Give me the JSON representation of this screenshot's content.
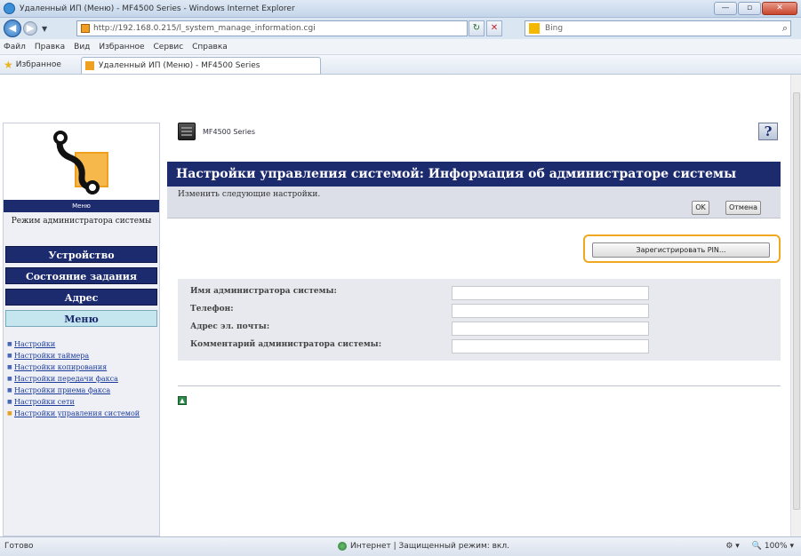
{
  "window": {
    "title": "Удаленный ИП (Меню) - MF4500 Series - Windows Internet Explorer",
    "url": "http://192.168.0.215/l_system_manage_information.cgi",
    "search_placeholder": "Bing",
    "controls": [
      "—",
      "▫",
      "✕"
    ]
  },
  "menu": [
    "Файл",
    "Правка",
    "Вид",
    "Избранное",
    "Сервис",
    "Справка"
  ],
  "favorites": {
    "label": "Избранное",
    "tab_title": "Удаленный ИП (Меню) - MF4500 Series"
  },
  "sidebar": {
    "mode_bar": "Меню",
    "mode_text": "Режим администратора системы",
    "buttons": [
      {
        "label": "Устройство",
        "active": false
      },
      {
        "label": "Состояние задания",
        "active": false
      },
      {
        "label": "Адрес",
        "active": false
      },
      {
        "label": "Меню",
        "active": true
      }
    ],
    "links": [
      {
        "label": "Настройки",
        "current": false
      },
      {
        "label": "Настройки таймера",
        "current": false
      },
      {
        "label": "Настройки копирования",
        "current": false
      },
      {
        "label": "Настройки передачи факса",
        "current": false
      },
      {
        "label": "Настройки приема факса",
        "current": false
      },
      {
        "label": "Настройки сети",
        "current": false
      },
      {
        "label": "Настройки управления системой",
        "current": true
      }
    ]
  },
  "main": {
    "printer_name": "MF4500 Series",
    "help": "?",
    "title": "Настройки управления системой: Информация об администраторе системы",
    "instruction": "Изменить следующие настройки.",
    "ok_label": "OK",
    "cancel_label": "Отмена",
    "pin_label": "Зарегистрировать PIN...",
    "form": [
      {
        "label": "Имя администратора системы:",
        "value": ""
      },
      {
        "label": "Телефон:",
        "value": ""
      },
      {
        "label": "Адрес эл. почты:",
        "value": ""
      },
      {
        "label": "Комментарий администратора системы:",
        "value": ""
      }
    ],
    "top_icon": "▲"
  },
  "status": {
    "left": "Готово",
    "zone": "Интернет | Защищенный режим: вкл.",
    "zoom": "100%"
  },
  "colors": {
    "navy": "#1c2a6e",
    "highlight": "#f0a820",
    "active_tab": "#c5e6ef"
  }
}
